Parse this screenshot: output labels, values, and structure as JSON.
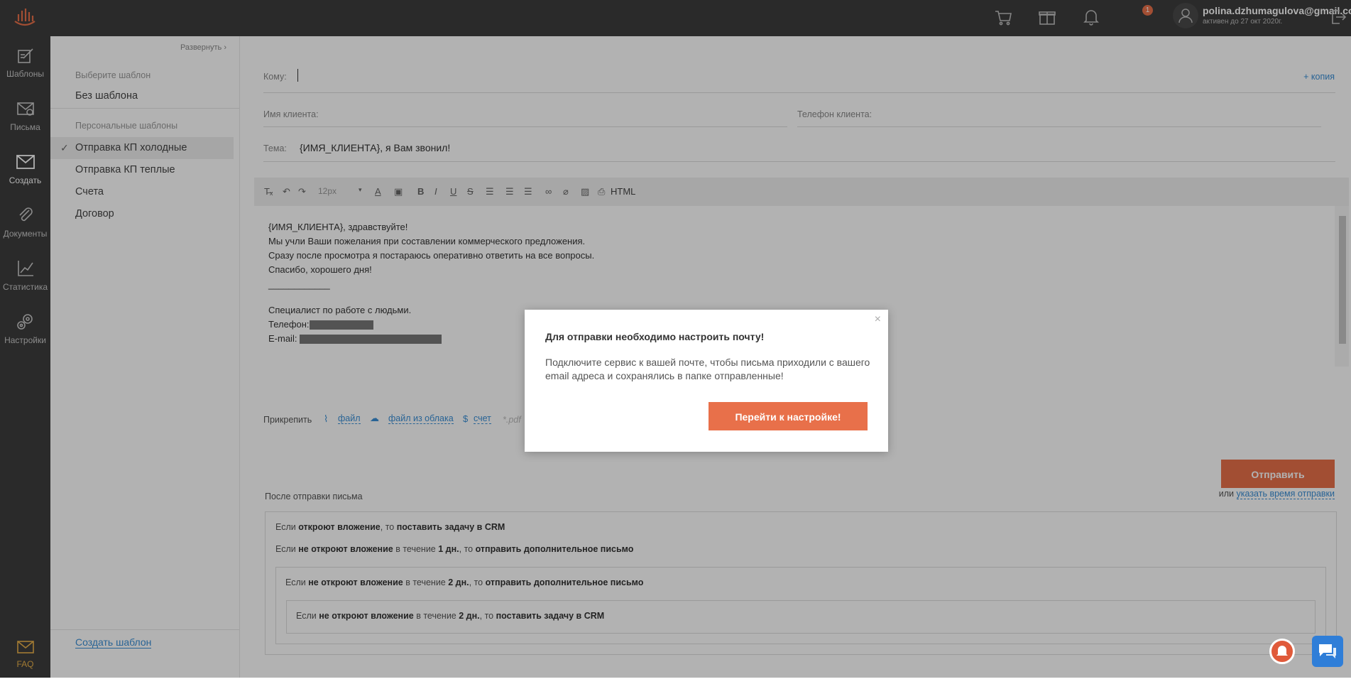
{
  "nav": {
    "items": [
      {
        "label": "Шаблоны",
        "icon": "templates-icon"
      },
      {
        "label": "Письма",
        "icon": "letters-icon"
      },
      {
        "label": "Создать",
        "icon": "create-mail-icon"
      },
      {
        "label": "Документы",
        "icon": "paperclip-icon"
      },
      {
        "label": "Статистика",
        "icon": "chart-icon"
      },
      {
        "label": "Настройки",
        "icon": "gear-icon"
      }
    ],
    "faq": "FAQ",
    "active": "Создать"
  },
  "topbar": {
    "notification_count": "1",
    "user_email": "polina.dzhumagulova@gmail.com",
    "user_sub": "активен до 27 окт 2020г."
  },
  "sidebar": {
    "expand": "Развернуть",
    "choose_caption": "Выберите шаблон",
    "no_template": "Без шаблона",
    "personal_caption": "Персональные шаблоны",
    "templates": [
      "Отправка КП холодные",
      "Отправка КП теплые",
      "Счета",
      "Договор"
    ],
    "selected": "Отправка КП холодные",
    "create_link": "Создать шаблон"
  },
  "form": {
    "to_label": "Кому:",
    "copy_link": "+ копия",
    "client_name_label": "Имя клиента:",
    "client_phone_label": "Телефон клиента:",
    "subject_label": "Тема:",
    "subject_value": "{ИМЯ_КЛИЕНТА}, я Вам звонил!"
  },
  "toolbar": {
    "font_size": "12px",
    "html": "HTML"
  },
  "editor": {
    "lines": [
      "{ИМЯ_КЛИЕНТА}, здравствуйте!",
      "Мы учли Ваши пожелания при составлении коммерческого предложения.",
      "Сразу после просмотра я постараюсь оперативно ответить на все вопросы.",
      "Спасибо, хорошего дня!"
    ],
    "signature_line": "____________",
    "signature": "Специалист по работе с людьми.",
    "phone_label": "Телефон:",
    "email_label": "E-mail:"
  },
  "attach": {
    "label": "Прикрепить",
    "file": "файл",
    "cloud": "файл из облака",
    "invoice": "счет",
    "pdf": "*.pdf"
  },
  "send": {
    "button": "Отправить",
    "or": "или",
    "schedule_link": "указать время отправки"
  },
  "rules": {
    "title": "После отправки письма",
    "r1": {
      "pre": "Если",
      "cond": "откроют вложение",
      "mid": ", то",
      "action": "поставить задачу в CRM"
    },
    "r2": {
      "pre": "Если",
      "cond": "не откроют вложение",
      "mid": "в течение",
      "days": "1 дн.",
      "mid2": ", то",
      "action": "отправить дополнительное письмо"
    },
    "r3": {
      "pre": "Если",
      "cond": "не откроют вложение",
      "mid": "в течение",
      "days": "2 дн.",
      "mid2": ", то",
      "action": "отправить дополнительное письмо"
    },
    "r4": {
      "pre": "Если",
      "cond": "не откроют вложение",
      "mid": "в течение",
      "days": "2 дн.",
      "mid2": ", то",
      "action": "поставить задачу в CRM"
    }
  },
  "modal": {
    "title": "Для отправки необходимо настроить почту!",
    "body": "Подключите сервис к вашей почте, чтобы письма приходили с вашего email адреса и сохранялись в папке отправленные!",
    "button": "Перейти к настройке!",
    "close": "×"
  },
  "colors": {
    "accent": "#e8704a",
    "link": "#3a8fd6",
    "dark": "#3d3d3d"
  }
}
